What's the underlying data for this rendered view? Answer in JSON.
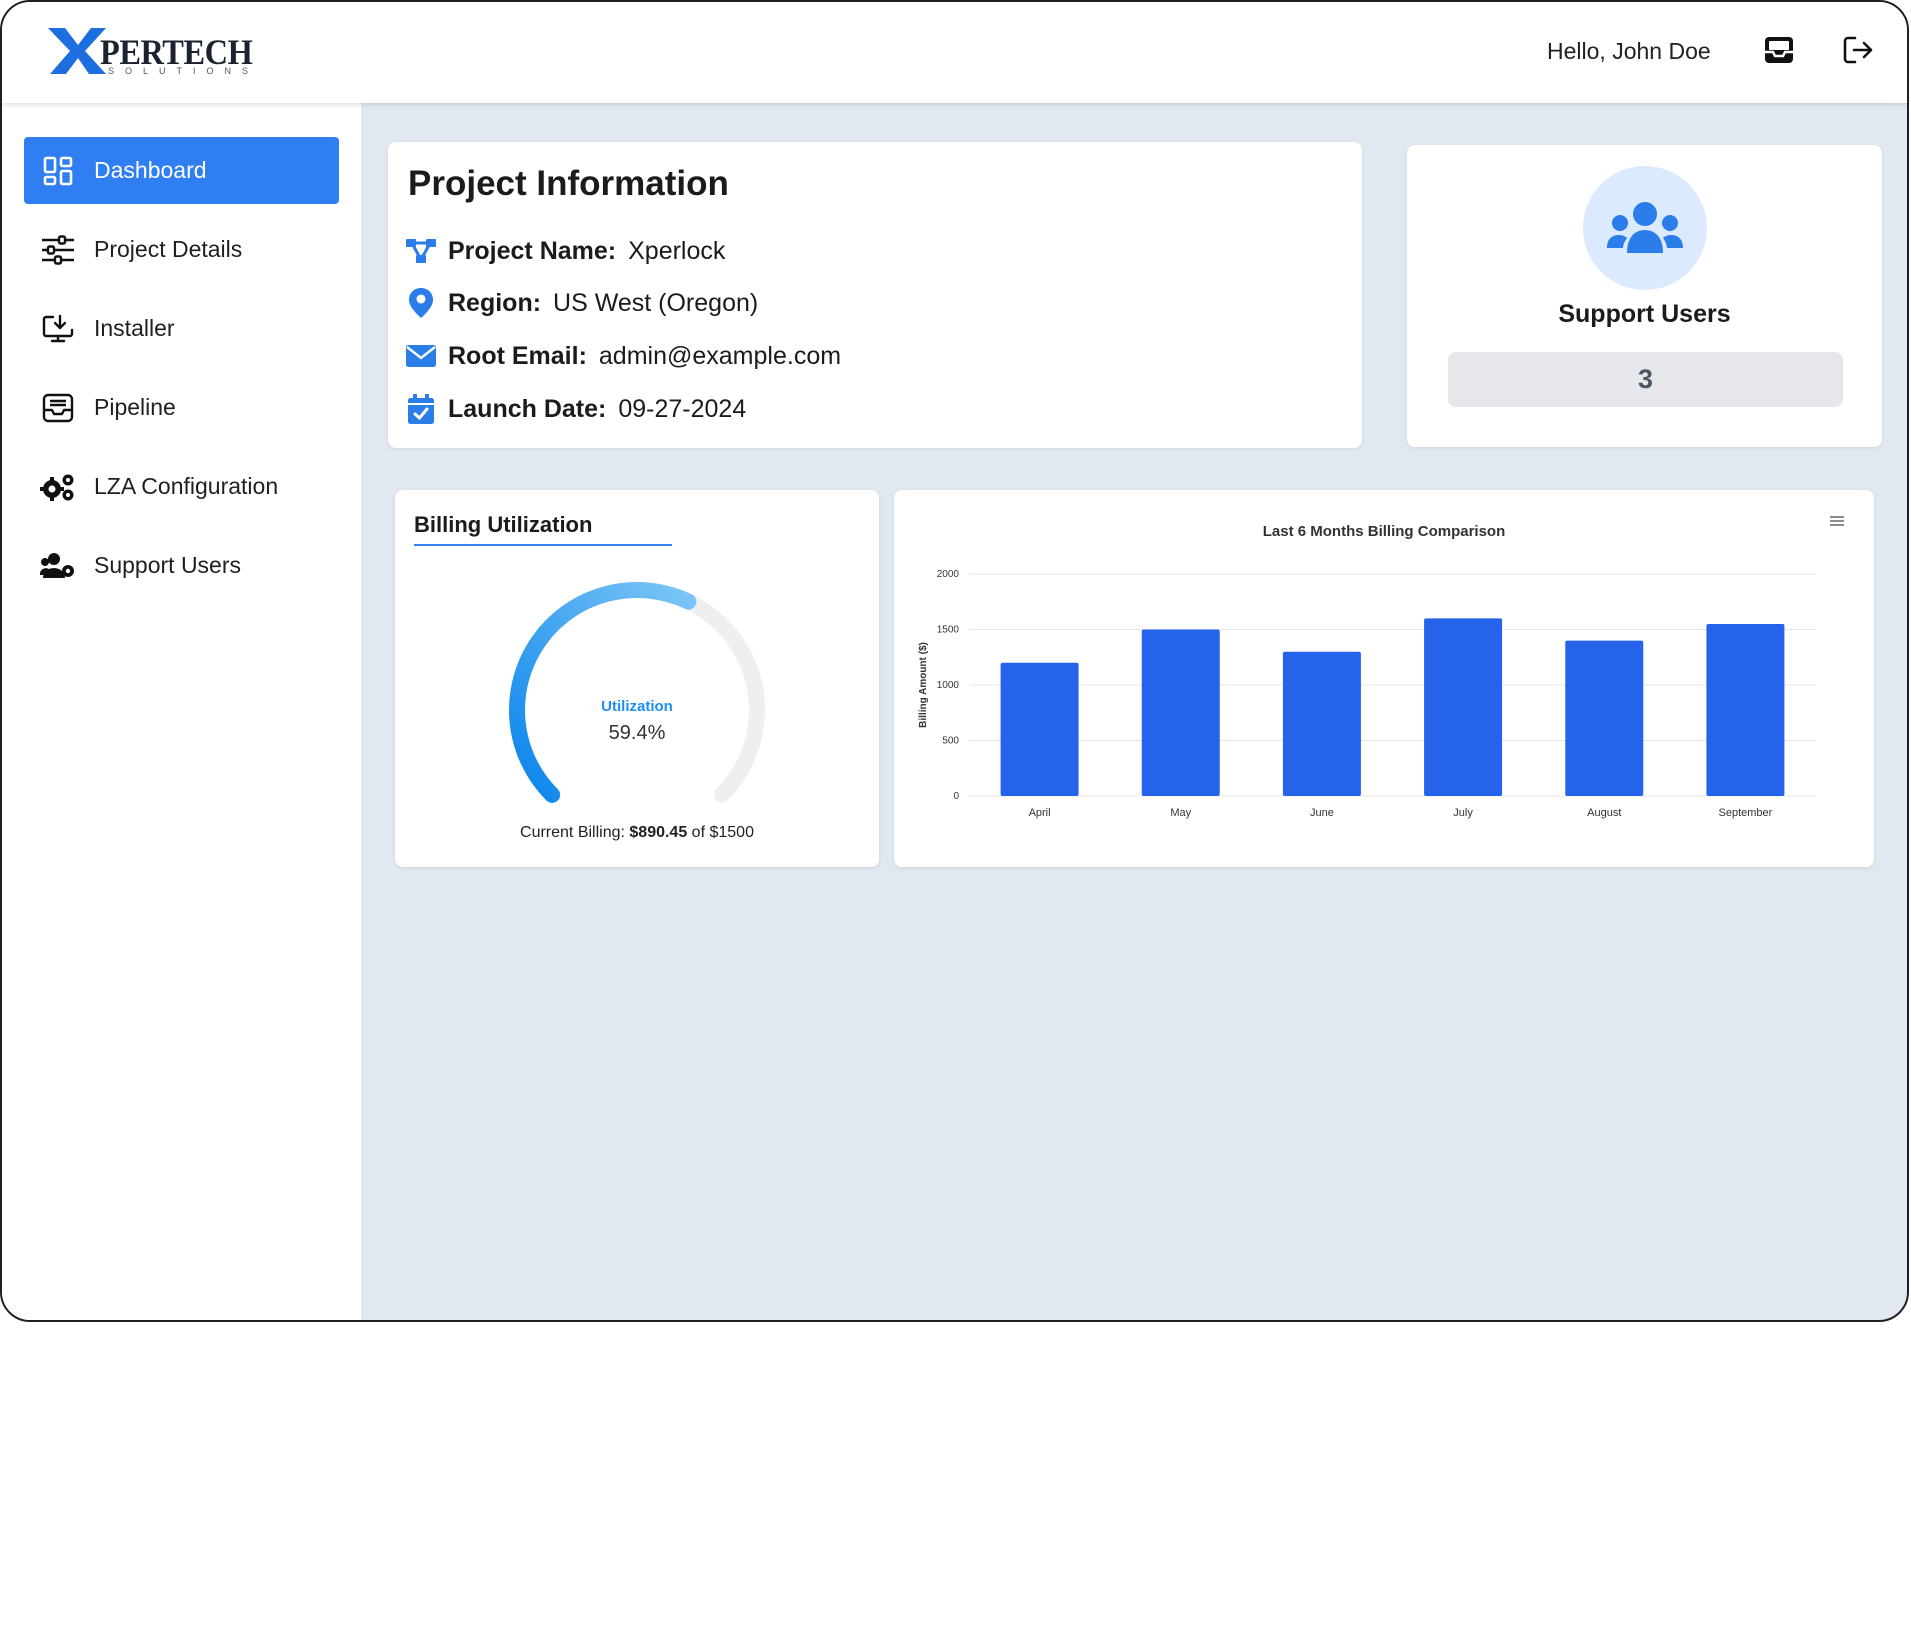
{
  "brand": {
    "logo_text": "PERTECH",
    "logo_sub": "SOLUTIONS"
  },
  "header": {
    "greeting": "Hello, John Doe",
    "icons": [
      "inbox-icon",
      "logout-icon"
    ]
  },
  "sidebar": {
    "items": [
      {
        "label": "Dashboard",
        "icon": "dashboard-icon",
        "active": true
      },
      {
        "label": "Project Details",
        "icon": "sliders-icon"
      },
      {
        "label": "Installer",
        "icon": "download-icon"
      },
      {
        "label": "Pipeline",
        "icon": "inbox-tray-icon"
      },
      {
        "label": "LZA Configuration",
        "icon": "gears-icon"
      },
      {
        "label": "Support Users",
        "icon": "users-icon"
      }
    ]
  },
  "project_info": {
    "title": "Project Information",
    "rows": [
      {
        "label": "Project Name:",
        "value": "Xperlock",
        "icon": "network-icon"
      },
      {
        "label": "Region:",
        "value": "US West (Oregon)",
        "icon": "location-pin-icon"
      },
      {
        "label": "Root Email:",
        "value": "admin@example.com",
        "icon": "envelope-icon"
      },
      {
        "label": "Launch Date:",
        "value": "09-27-2024",
        "icon": "calendar-check-icon"
      }
    ]
  },
  "support_users": {
    "title": "Support Users",
    "count": "3"
  },
  "billing": {
    "title": "Billing Utilization",
    "gauge_label": "Utilization",
    "gauge_value": "59.4%",
    "utilization_percent": 59.4,
    "footer_prefix": "Current Billing: ",
    "current": "$890.45",
    "footer_suffix": " of $1500"
  },
  "colors": {
    "accent": "#2f7ff3",
    "bar": "#2563eb",
    "background": "#e2e8f0"
  },
  "chart_data": {
    "type": "bar",
    "title": "Last 6 Months Billing Comparison",
    "xlabel": "",
    "ylabel": "Billing Amount ($)",
    "categories": [
      "April",
      "May",
      "June",
      "July",
      "August",
      "September"
    ],
    "values": [
      1200,
      1500,
      1300,
      1600,
      1400,
      1550
    ],
    "ylim": [
      0,
      2000
    ],
    "yticks": [
      0,
      500,
      1000,
      1500,
      2000
    ],
    "grid": true,
    "legend": "none"
  }
}
